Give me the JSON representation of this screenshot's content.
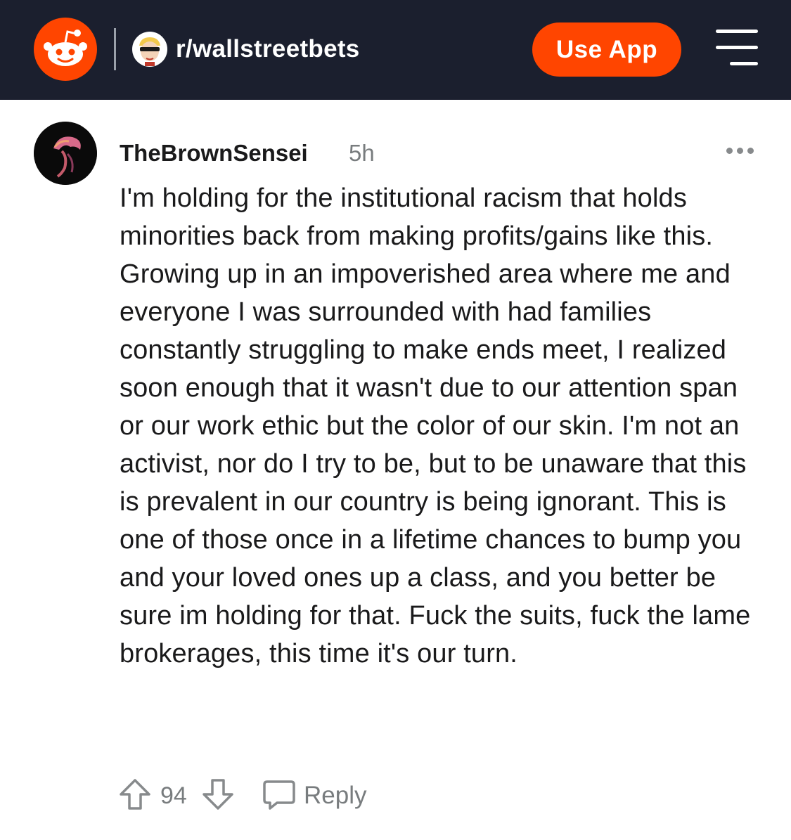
{
  "header": {
    "logo_icon": "reddit-snoo-icon",
    "subreddit_icon": "wallstreetbets-avatar-icon",
    "subreddit_name": "r/wallstreetbets",
    "use_app_label": "Use App",
    "menu_icon": "hamburger-menu-icon",
    "brand_color": "#ff4500",
    "bar_color": "#1b1f2e"
  },
  "comment": {
    "author": "TheBrownSensei",
    "age": "5h",
    "more_icon": "more-options-icon",
    "body": "I'm holding for the institutional racism that holds minorities back from making profits/gains like this. Growing up in an impoverished area where me and everyone I was surrounded with had families constantly struggling to make ends meet, I realized soon enough that it wasn't due to our attention span or our work ethic but the color of our skin. I'm not an activist, nor do I try to be, but to be unaware that this is prevalent in our country is being ignorant. This is one of those once in a lifetime chances to bump you and your loved ones up a class, and you better be sure im holding for that. Fuck the suits, fuck the lame brokerages, this time it's our turn.",
    "score": "94",
    "reply_label": "Reply"
  }
}
